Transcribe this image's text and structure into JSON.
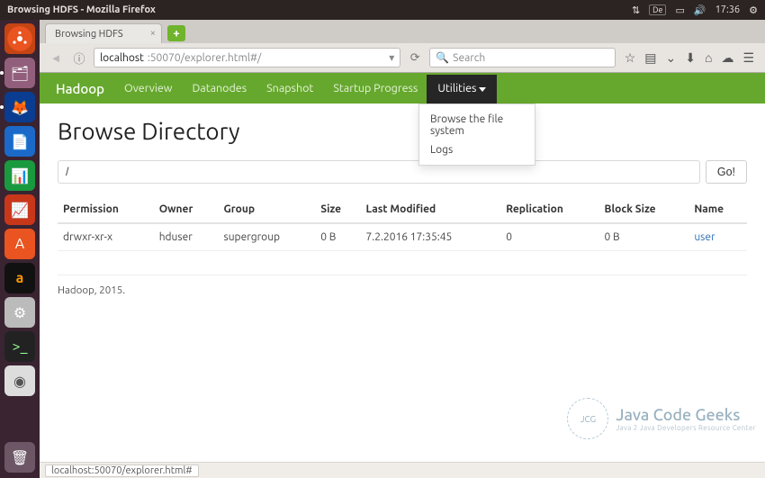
{
  "panel": {
    "window_title": "Browsing HDFS - Mozilla Firefox",
    "indicators": {
      "keyboard": "De",
      "time": "17:36"
    }
  },
  "browser": {
    "tab_title": "Browsing HDFS",
    "url_host": "localhost",
    "url_rest": ":50070/explorer.html#/",
    "search_placeholder": "Search",
    "reload_tooltip": "Reload"
  },
  "navbar": {
    "brand": "Hadoop",
    "links": [
      "Overview",
      "Datanodes",
      "Snapshot",
      "Startup Progress"
    ],
    "utilities_label": "Utilities",
    "dropdown": [
      "Browse the file system",
      "Logs"
    ]
  },
  "page": {
    "heading": "Browse Directory",
    "path_value": "/",
    "go_label": "Go!",
    "columns": [
      "Permission",
      "Owner",
      "Group",
      "Size",
      "Last Modified",
      "Replication",
      "Block Size",
      "Name"
    ],
    "rows": [
      {
        "permission": "drwxr-xr-x",
        "owner": "hduser",
        "group": "supergroup",
        "size": "0 B",
        "modified": "7.2.2016 17:35:45",
        "replication": "0",
        "blocksize": "0 B",
        "name": "user"
      }
    ],
    "footer": "Hadoop, 2015."
  },
  "watermark": {
    "badge": "JCG",
    "line1": "Java Code Geeks",
    "line2": "Java 2 Java Developers Resource Center"
  },
  "statusbar": {
    "hover_url": "localhost:50070/explorer.html#"
  }
}
